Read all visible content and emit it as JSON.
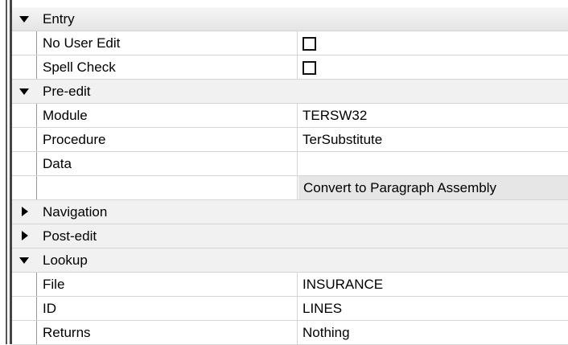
{
  "properties": {
    "entry": {
      "label": "Entry",
      "no_user_edit": {
        "label": "No User Edit",
        "checked": false
      },
      "spell_check": {
        "label": "Spell Check",
        "checked": false
      }
    },
    "pre_edit": {
      "label": "Pre-edit",
      "module": {
        "label": "Module",
        "value": "TERSW32"
      },
      "procedure": {
        "label": "Procedure",
        "value": "TerSubstitute"
      },
      "data": {
        "label": "Data",
        "value": ""
      },
      "convert_button_label": "Convert to Paragraph Assembly"
    },
    "navigation": {
      "label": "Navigation"
    },
    "post_edit": {
      "label": "Post-edit"
    },
    "lookup": {
      "label": "Lookup",
      "file": {
        "label": "File",
        "value": "INSURANCE"
      },
      "id": {
        "label": "ID",
        "value": "LINES"
      },
      "returns": {
        "label": "Returns",
        "value": "Nothing"
      }
    }
  }
}
